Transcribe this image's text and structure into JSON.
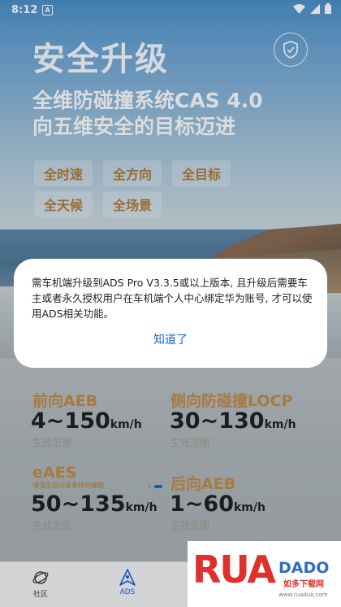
{
  "status_bar": {
    "time": "8:12",
    "notification_badge": "A"
  },
  "header": {
    "title": "安全升级",
    "subtitle_line1": "全维防碰撞系统CAS 4.0",
    "subtitle_line2": "向五维安全的目标迈进"
  },
  "features": [
    "全时速",
    "全方向",
    "全目标",
    "全天候",
    "全场景"
  ],
  "stats": [
    {
      "label": "前向AEB",
      "range": "4~150",
      "unit": "km/h",
      "note": "生效范围",
      "sublabel": ""
    },
    {
      "label": "侧向防碰撞LOCP",
      "range": "30~130",
      "unit": "km/h",
      "note": "生效范围",
      "sublabel": ""
    },
    {
      "label": "eAES",
      "range": "50~135",
      "unit": "km/h",
      "note": "生效范围",
      "sublabel": "增强型自动紧急转向辅助"
    },
    {
      "label": "后向AEB",
      "range": "1~60",
      "unit": "km/h",
      "note": "生效范围",
      "sublabel": ""
    }
  ],
  "dialog": {
    "message": "需车机端升级到ADS Pro V3.3.5或以上版本, 且升级后需要车主或者永久授权用户在车机端个人中心绑定华为账号, 才可以使用ADS相关功能。",
    "button": "知道了"
  },
  "bottom_nav": [
    {
      "label": "社区",
      "icon": "planet-icon"
    },
    {
      "label": "ADS",
      "icon": "ads-icon",
      "active": true
    }
  ],
  "watermark": {
    "brand": "RUANDADO",
    "chinese": "如多下载网",
    "url": "www.ruaduo.com"
  },
  "colors": {
    "accent": "#1463d6",
    "feature_text": "#b07a3a",
    "watermark_red": "#e0302b"
  }
}
